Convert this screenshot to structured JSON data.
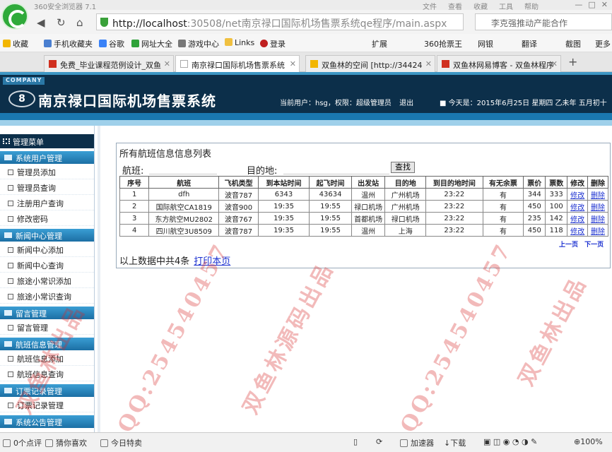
{
  "browser": {
    "window_title": "360安全浏览器 7.1",
    "menus": [
      "文件",
      "查看",
      "收藏",
      "工具",
      "帮助"
    ],
    "address_host": "http://localhost",
    "address_rest": ":30508/net南京禄口国际机场售票系统qe程序/main.aspx",
    "search_placeholder": "李克强推动产能合作",
    "favorites": [
      {
        "label": "收藏",
        "color": "#f2b600"
      },
      {
        "label": "手机收藏夹",
        "color": "#4a7fd0"
      },
      {
        "label": "谷歌",
        "color": "#3a82f7"
      },
      {
        "label": "网址大全",
        "color": "#2fa23a"
      },
      {
        "label": "游戏中心",
        "color": "#777777"
      },
      {
        "label": "Links",
        "color": "#f0c040"
      },
      {
        "label": "登录",
        "color": "#c02020"
      }
    ],
    "right_tools": [
      "扩展",
      "360抢票王",
      "网银",
      "翻译",
      "截图",
      "更多"
    ],
    "tabs": [
      {
        "label": "免费_毕业课程范例设计_双鱼",
        "active": false,
        "color": "#d03020"
      },
      {
        "label": "南京禄口国际机场售票系统",
        "active": true,
        "color": "#ffffff"
      },
      {
        "label": "双鱼林的空间 [http://34424",
        "active": false,
        "color": "#f2b600"
      },
      {
        "label": "双鱼林网易博客 - 双鱼林程序",
        "active": false,
        "color": "#d03020"
      }
    ]
  },
  "header": {
    "company": "COMPANY",
    "logo_text": "8",
    "title": "南京禄口国际机场售票系统",
    "current_user": "当前用户：hsg，权限：超级管理员",
    "logout": "退出",
    "today": "■ 今天是：2015年6月25日 星期四 乙未年 五月初十"
  },
  "sidebar": {
    "main_label": "管理菜单",
    "groups": [
      {
        "label": "系统用户管理",
        "items": [
          "管理员添加",
          "管理员查询",
          "注册用户查询",
          "修改密码"
        ]
      },
      {
        "label": "新闻中心管理",
        "items": [
          "新闻中心添加",
          "新闻中心查询",
          "旅途小常识添加",
          "旅途小常识查询"
        ]
      },
      {
        "label": "留言管理",
        "items": [
          "留言管理"
        ]
      },
      {
        "label": "航班信息管理",
        "items": [
          "航班信息添加",
          "航班信息查询"
        ]
      },
      {
        "label": "订票记录管理",
        "items": [
          "订票记录管理"
        ]
      },
      {
        "label": "系统公告管理",
        "items": []
      }
    ]
  },
  "main": {
    "list_title": "所有航班信息信息列表",
    "flight_label": "航班:",
    "flight_value": "",
    "dest_label": "目的地:",
    "dest_value": "",
    "search_button": "查找",
    "columns": [
      "序号",
      "航班",
      "飞机类型",
      "到本站时间",
      "起飞时间",
      "出发站",
      "目的地",
      "到目的地时间",
      "有无余票",
      "票价",
      "票数",
      "修改",
      "删除"
    ],
    "rows": [
      [
        "1",
        "dfh",
        "波音787",
        "6343",
        "43634",
        "温州",
        "广州机场",
        "23:22",
        "有",
        "344",
        "333",
        "修改",
        "删除"
      ],
      [
        "2",
        "国际航空CA1819",
        "波音900",
        "19:35",
        "19:55",
        "禄口机场",
        "广州机场",
        "23:22",
        "有",
        "450",
        "100",
        "修改",
        "删除"
      ],
      [
        "3",
        "东方航空MU2802",
        "波音767",
        "19:35",
        "19:55",
        "首都机场",
        "禄口机场",
        "23:22",
        "有",
        "235",
        "142",
        "修改",
        "删除"
      ],
      [
        "4",
        "四川航空3U8509",
        "波音787",
        "19:35",
        "19:55",
        "温州",
        "上海",
        "23:22",
        "有",
        "450",
        "118",
        "修改",
        "删除"
      ]
    ],
    "prev_page": "上一页",
    "next_page": "下一页",
    "summary": "以上数据中共4条",
    "print_link": "打印本页"
  },
  "statusbar": {
    "items": [
      "0个点评",
      "猜你喜欢",
      "今日特卖",
      "加速器",
      "下载",
      "100%"
    ]
  },
  "watermark": [
    "双鱼林出品",
    "QQ:254540457",
    "双鱼林源码出品",
    "QQ:254540457"
  ]
}
